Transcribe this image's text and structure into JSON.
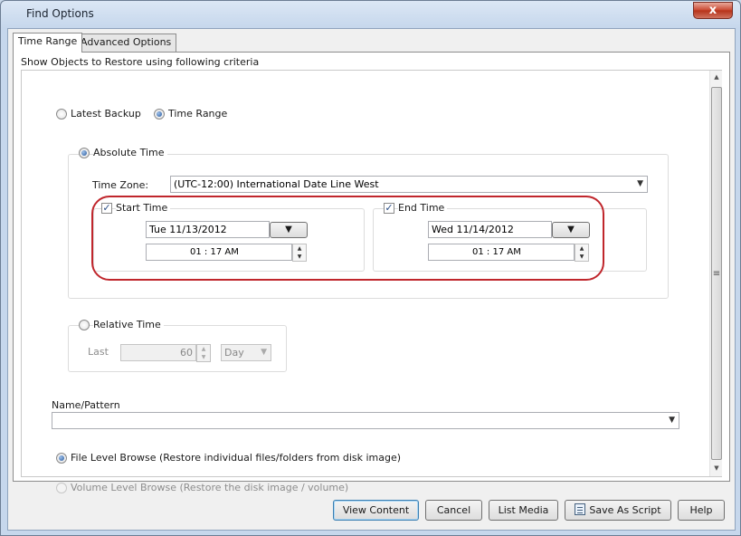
{
  "window": {
    "title": "Find Options",
    "close_label": "x"
  },
  "tabs": [
    {
      "label": "Time Range",
      "active": true
    },
    {
      "label": "Advanced Options",
      "active": false
    }
  ],
  "panel": {
    "criteria_label": "Show Objects to Restore using following criteria",
    "mode": {
      "latest_backup_label": "Latest Backup",
      "time_range_label": "Time Range",
      "selected": "Time Range"
    },
    "absolute_time": {
      "label": "Absolute Time",
      "selected": true,
      "time_zone_label": "Time Zone:",
      "time_zone_value": "(UTC-12:00) International Date Line West",
      "start": {
        "label": "Start Time",
        "checked": true,
        "date": "Tue 11/13/2012",
        "time": "01 : 17 AM"
      },
      "end": {
        "label": "End Time",
        "checked": true,
        "date": "Wed 11/14/2012",
        "time": "01 : 17 AM"
      }
    },
    "relative_time": {
      "label": "Relative Time",
      "selected": false,
      "last_label": "Last",
      "last_value": "60",
      "unit": "Day"
    },
    "name_pattern": {
      "label": "Name/Pattern",
      "value": ""
    },
    "browse": {
      "file_level_label": "File Level Browse (Restore individual files/folders from disk image)",
      "volume_level_label": "Volume Level Browse (Restore the disk image / volume)",
      "selected": "file_level"
    }
  },
  "buttons": {
    "view_content": "View Content",
    "cancel": "Cancel",
    "list_media": "List Media",
    "save_as_script": "Save As Script",
    "help": "Help"
  },
  "colors": {
    "highlight_ring": "#c0262c",
    "title_bar": "#c6d7ec"
  }
}
